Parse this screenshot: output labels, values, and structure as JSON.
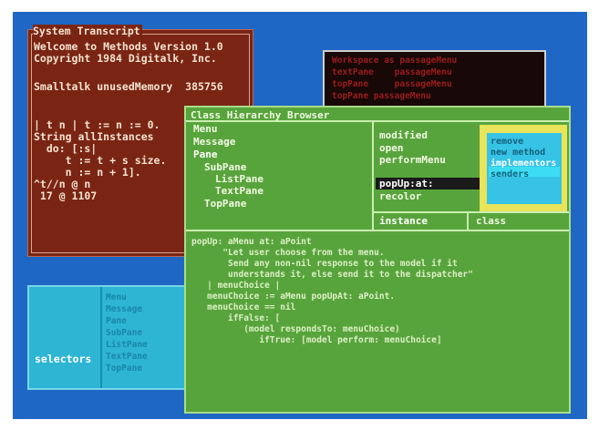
{
  "transcript": {
    "title": "System Transcript",
    "lines": [
      "Welcome to Methods Version 1.0",
      "Copyright 1984 Digitalk, Inc.",
      "",
      "Smalltalk unusedMemory  385756",
      "",
      "| t n | t := n := 0.",
      "String allInstances",
      "  do: [:s|",
      "     t := t + s size.",
      "     n := n + 1].",
      "^t//n @ n",
      " 17 @ 1107"
    ]
  },
  "dark_window": {
    "lines": [
      "Workspace as passageMenu",
      "textPane    passageMenu",
      "topPane     passageMenu",
      "topPane passageMenu"
    ]
  },
  "cyan_window": {
    "left_items": [
      "",
      "",
      "",
      "",
      ""
    ],
    "selected": "selectors",
    "right_items": [
      "Menu",
      "Message",
      "Pane",
      "SubPane",
      "ListPane",
      "TextPane",
      "TopPane"
    ]
  },
  "browser": {
    "title": "Class Hierarchy Browser",
    "classes": [
      "Menu",
      "Message",
      "Pane",
      "SubPane",
      "ListPane",
      "TextPane",
      "TopPane"
    ],
    "selected_class": "Pane",
    "methods": [
      "modified",
      "open",
      "performMenu",
      "popUp:at:",
      "recolor"
    ],
    "selected_method": "popUp:at:",
    "instance_label": "instance",
    "class_label": "class",
    "menu_items": [
      "remove",
      "new method",
      "implementors",
      "senders"
    ],
    "selected_menu_item": "implementors",
    "code": [
      "popUp: aMenu at: aPoint",
      "      \"Let user choose from the menu.",
      "       Send any non-nil response to the model if it",
      "       understands it, else send it to the dispatcher\"",
      "   | menuChoice |",
      "   menuChoice := aMenu popUpAt: aPoint.",
      "   menuChoice == nil",
      "       ifFalse: [",
      "          (model respondsTo: menuChoice)",
      "             ifTrue: [model perform: menuChoice]"
    ]
  },
  "colors": {
    "screen_bg": "#1f67c4",
    "transcript_bg": "#7a2514",
    "browser_bg": "#58a43c",
    "highlight_menu_bg": "#36c3e6",
    "yellow_frame": "#e9e45a"
  }
}
